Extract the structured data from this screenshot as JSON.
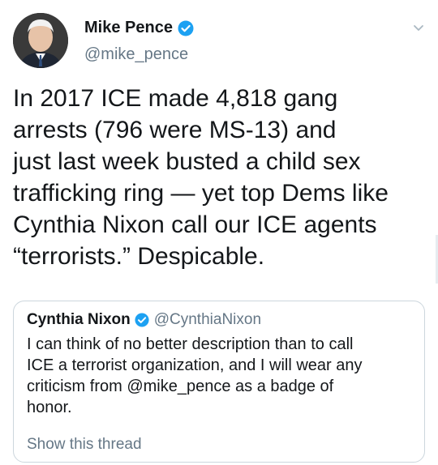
{
  "tweet": {
    "author_name": "Mike Pence",
    "author_handle": "@mike_pence",
    "text": "In 2017 ICE made 4,818 gang\narrests (796 were MS-13) and\njust last week busted a child sex\ntrafficking ring — yet top Dems like\nCynthia Nixon call our ICE agents\n“terrorists.” Despicable."
  },
  "quoted_tweet": {
    "author_name": "Cynthia Nixon",
    "author_handle": "@CynthiaNixon",
    "text": "I can think of no better description than to call\nICE a terrorist organization, and I will wear any\ncriticism from @mike_pence as a badge of\nhonor.",
    "show_thread_label": "Show this thread"
  },
  "icons": {
    "verified": "verified-badge-icon",
    "menu": "chevron-down-icon"
  },
  "colors": {
    "verified_blue": "#1da1f2",
    "secondary_text": "#657786",
    "border": "#ccd6dd"
  }
}
